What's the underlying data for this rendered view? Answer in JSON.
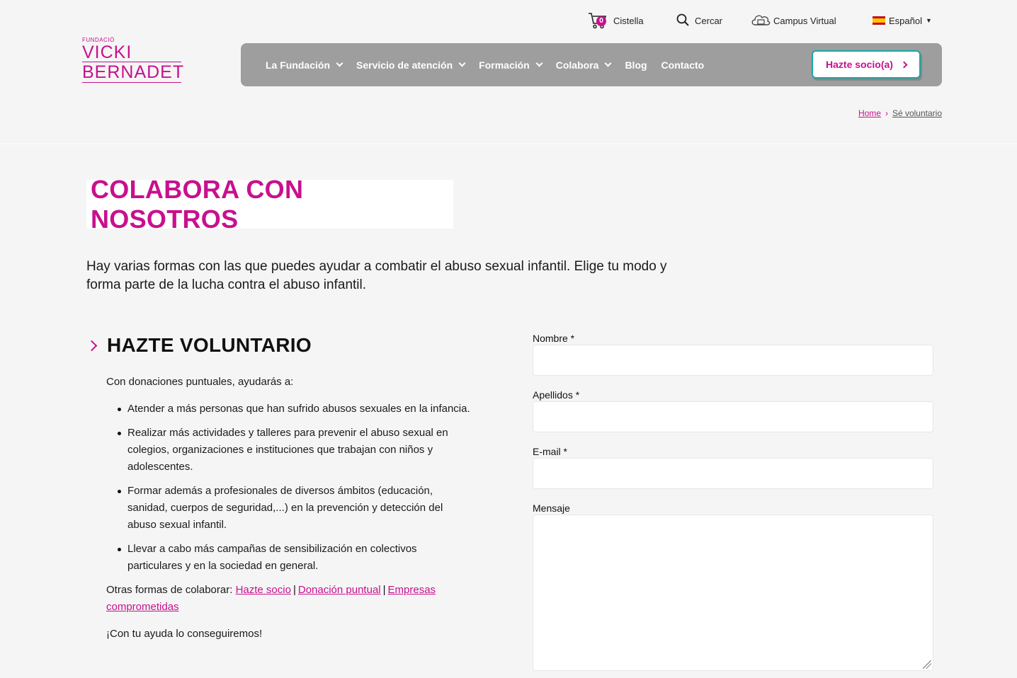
{
  "utility": {
    "cart_count": "0",
    "cart_label": "Cistella",
    "search_label": "Cercar",
    "campus_label": "Campus Virtual",
    "language_label": "Español"
  },
  "logo": {
    "line_small": "FUNDACIÓ",
    "line1": "VICKI",
    "line2": "BERNADET"
  },
  "nav": {
    "items": [
      {
        "label": "La Fundación"
      },
      {
        "label": "Servicio de atención"
      },
      {
        "label": "Formación"
      },
      {
        "label": "Colabora"
      },
      {
        "label": "Blog"
      },
      {
        "label": "Contacto"
      }
    ],
    "cta_label": "Hazte socio(a)"
  },
  "breadcrumb": {
    "home": "Home",
    "current": "Sé voluntario"
  },
  "page": {
    "title": "COLABORA CON NOSOTROS",
    "intro": "Hay varias formas con las que puedes ayudar a combatir el abuso sexual infantil. Elige tu modo y forma parte de la lucha contra el abuso infantil."
  },
  "section": {
    "heading": "HAZTE VOLUNTARIO",
    "lead": "Con donaciones puntuales, ayudarás a:",
    "bullets": [
      "Atender a más personas que han sufrido abusos sexuales en la infancia.",
      "Realizar más actividades y talleres para prevenir el abuso sexual en colegios, organizaciones e instituciones que trabajan con niños y adolescentes.",
      "Formar además a profesionales de diversos ámbitos (educación, sanidad, cuerpos de seguridad,...) en la prevención y detección del abuso sexual infantil.",
      "Llevar a cabo más campañas de sensibilización en colectivos particulares y en la sociedad en general."
    ],
    "other_prefix": "Otras formas de colaborar: ",
    "links": [
      "Hazte socio",
      "Donación puntual",
      "Empresas comprometidas"
    ],
    "pipe": "|",
    "closing": "¡Con tu ayuda lo conseguiremos!"
  },
  "form": {
    "nombre_label": "Nombre *",
    "apellidos_label": "Apellidos *",
    "email_label": "E-mail *",
    "mensaje_label": "Mensaje"
  },
  "colors": {
    "brand": "#c8108e",
    "nav_bg": "#9e9e9e",
    "cta_border": "#1aa6a6"
  }
}
